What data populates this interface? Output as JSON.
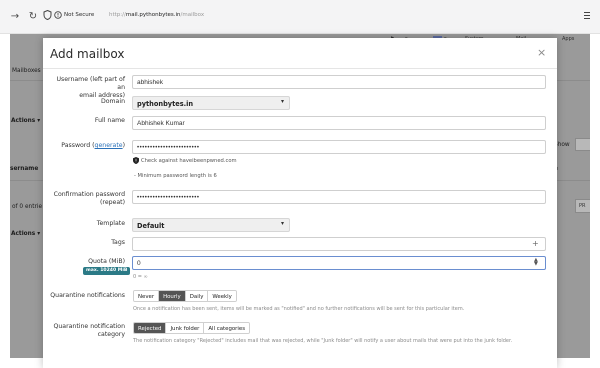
{
  "browser": {
    "security_label": "Not Secure",
    "url_prefix": "http://",
    "url_host": "mail.pythonbytes.in",
    "url_path": "/mailbox"
  },
  "backdrop": {
    "mailboxes_tab": "Mailboxes",
    "actions_1": "Actions",
    "username_header": "sername",
    "entries_text": "of 0 entrie",
    "actions_2": "Actions",
    "show_label": "Show",
    "e_header": "e",
    "nav_system": "System",
    "nav_mail": "Mail",
    "nav_apps": "Apps",
    "pr_label": "PR"
  },
  "modal": {
    "title": "Add mailbox",
    "close_symbol": "×"
  },
  "form": {
    "username": {
      "label_line1": "Username (left part of an",
      "label_line2": "email address)",
      "value": "abhishek"
    },
    "domain": {
      "label": "Domain",
      "value": "pythonbytes.in"
    },
    "fullname": {
      "label": "Full name",
      "value": "Abhishek Kumar"
    },
    "password": {
      "label_prefix": "Password (",
      "generate_link": "generate",
      "label_suffix": ")",
      "masked": "••••••••••••••••••••••••",
      "hibp_text": "Check against haveibeenpwned.com",
      "min_length_text": "- Minimum password length is 6"
    },
    "confirm_password": {
      "label_line1": "Confirmation password",
      "label_line2": "(repeat)",
      "masked": "••••••••••••••••••••••••"
    },
    "template": {
      "label": "Template",
      "value": "Default"
    },
    "tags": {
      "label": "Tags",
      "add_symbol": "+"
    },
    "quota": {
      "label": "Quota (MiB)",
      "max_badge": "max. 10240 MiB",
      "value": "0",
      "help": "0 = ∞",
      "spinner_up": "▲",
      "spinner_down": "▼"
    },
    "quarantine_notifications": {
      "label": "Quarantine notifications",
      "options": [
        "Never",
        "Hourly",
        "Daily",
        "Weekly"
      ],
      "selected": "Hourly",
      "help": "Once a notification has been sent, items will be marked as \"notified\" and no further notifications will be sent for this particular item."
    },
    "quarantine_category": {
      "label_line1": "Quarantine notification",
      "label_line2": "category",
      "options": [
        "Rejected",
        "Junk folder",
        "All categories"
      ],
      "selected": "Rejected",
      "help": "The notification category \"Rejected\" includes mail that was rejected, while \"Junk folder\" will notify a user about mails that were put into the junk folder."
    }
  },
  "colors": {
    "accent_badge": "#2b7a86",
    "link": "#2a70b8",
    "active_toggle": "#555555",
    "backdrop": "#9a9a9a"
  }
}
